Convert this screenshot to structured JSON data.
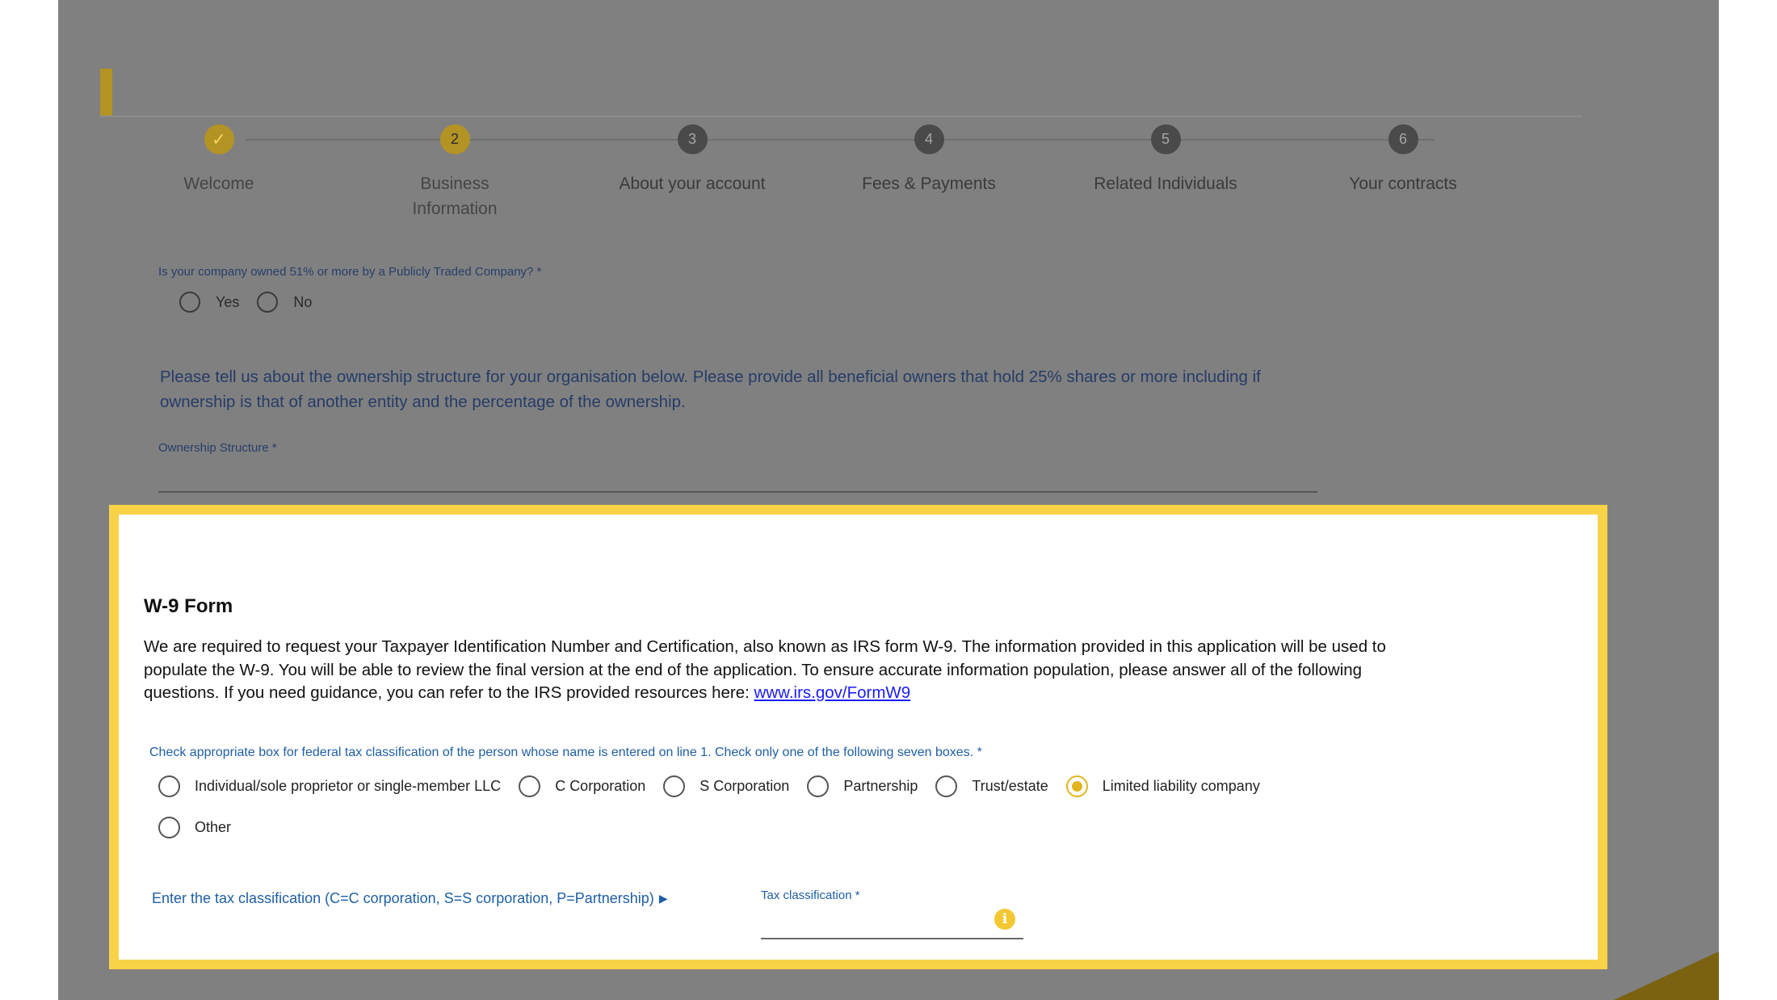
{
  "colors": {
    "accent_yellow": "#f8d247",
    "overlay_gray": "#808080",
    "step_done": "#b39324",
    "step_pending": "#4a4a4a",
    "link_blue": "#1a1aff",
    "label_blue": "#1f5fa6",
    "radio_selected": "#e2b51f",
    "accent_bar": "#b39324"
  },
  "stepper": {
    "steps": [
      {
        "number": "✓",
        "label": "Welcome",
        "state": "done"
      },
      {
        "number": "2",
        "label": "Business\nInformation",
        "state": "current"
      },
      {
        "number": "3",
        "label": "About your account",
        "state": "pending"
      },
      {
        "number": "4",
        "label": "Fees & Payments",
        "state": "pending"
      },
      {
        "number": "5",
        "label": "Related Individuals",
        "state": "pending"
      },
      {
        "number": "6",
        "label": "Your contracts",
        "state": "pending"
      }
    ]
  },
  "public_company": {
    "question": "Is your company owned 51% or more by a Publicly Traded Company? *",
    "options": [
      "Yes",
      "No"
    ]
  },
  "ownership": {
    "paragraph": "Please tell us about the ownership structure for your organisation below. Please provide all beneficial owners that hold 25% shares or more including if ownership is that of another entity and the percentage of the ownership.",
    "field_label": "Ownership Structure *"
  },
  "w9": {
    "title": "W-9 Form",
    "description": "We are required to request your Taxpayer Identification Number and Certification, also known as IRS form W-9. The information provided in this application will be used to populate the W-9. You will be able to review the final version at the end of the application. To ensure accurate information population, please answer all of the following questions. If you need guidance, you can refer to the IRS provided resources here: ",
    "link_text": "www.irs.gov/FormW9",
    "classification_question": "Check appropriate box for federal tax classification of the person whose name is entered on line 1. Check only one of the following seven boxes. *",
    "classification_options": [
      {
        "label": "Individual/sole proprietor or single-member LLC",
        "selected": false
      },
      {
        "label": "C Corporation",
        "selected": false
      },
      {
        "label": "S Corporation",
        "selected": false
      },
      {
        "label": "Partnership",
        "selected": false
      },
      {
        "label": "Trust/estate",
        "selected": false
      },
      {
        "label": "Limited liability company",
        "selected": true
      },
      {
        "label": "Other",
        "selected": false
      }
    ],
    "tax_help_text": "Enter the tax classification (C=C corporation, S=S corporation, P=Partnership)",
    "tax_help_arrow_icon": "play-arrow-icon",
    "tax_field_label": "Tax classification  *",
    "tax_field_value": "",
    "info_icon": "info-icon"
  }
}
